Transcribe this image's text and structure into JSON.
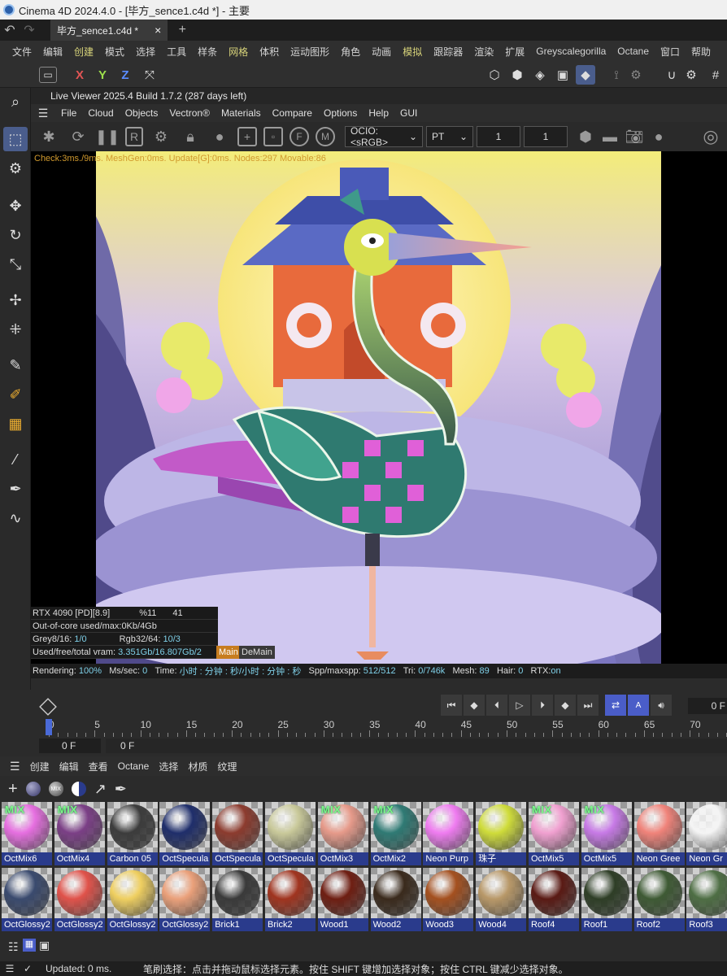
{
  "window": {
    "title": "Cinema 4D 2024.4.0 - [毕方_sence1.c4d *] - 主要"
  },
  "tabbar": {
    "doc_tab": "毕方_sence1.c4d *",
    "close": "×",
    "add": "+"
  },
  "menubar": {
    "items": [
      "文件",
      "编辑",
      "创建",
      "模式",
      "选择",
      "工具",
      "样条",
      "网格",
      "体积",
      "运动图形",
      "角色",
      "动画",
      "模拟",
      "跟踪器",
      "渲染",
      "扩展",
      "Greyscalegorilla",
      "Octane",
      "窗口",
      "帮助"
    ]
  },
  "toolbar1": {
    "axis_x": "X",
    "axis_y": "Y",
    "axis_z": "Z"
  },
  "liveviewer": {
    "title": "Live Viewer 2025.4 Build 1.7.2 (287 days left)",
    "menu": [
      "File",
      "Cloud",
      "Objects",
      "Vectron®",
      "Materials",
      "Compare",
      "Options",
      "Help",
      "GUI"
    ],
    "ocio": "OCIO:<sRGB>",
    "kernel": "PT",
    "field1": "1",
    "field2": "1",
    "check_line": "Check:3ms./9ms. MeshGen:0ms. Update[G]:0ms. Nodes:297 Movable:86"
  },
  "stats": {
    "gpu": "RTX 4090 [PD][8.9]",
    "gpu_pct": "%11",
    "gpu_temp": "41",
    "ooc_label": "Out-of-core used/max:",
    "ooc_value": "0Kb/4Gb",
    "grey_label": "Grey8/16:",
    "grey_value": "1/0",
    "rgb_label": "Rgb32/64:",
    "rgb_value": "10/3",
    "vram_label": "Used/free/total vram:",
    "vram_value": "3.351Gb/16.807Gb/2",
    "main_tab": "Main",
    "demain_tab": "DeMain"
  },
  "render_status": {
    "rendering_label": "Rendering:",
    "rendering_value": "100%",
    "ms_label": "Ms/sec:",
    "ms_value": "0",
    "time_label": "Time:",
    "time_value": "小时 : 分钟 : 秒/小时 : 分钟 : 秒",
    "spp_label": "Spp/maxspp:",
    "spp_value": "512/512",
    "tri_label": "Tri:",
    "tri_value": "0/746k",
    "mesh_label": "Mesh:",
    "mesh_value": "89",
    "hair_label": "Hair:",
    "hair_value": "0",
    "rtx_label": "RTX:",
    "rtx_value": "on"
  },
  "timeline": {
    "frame_right": "0 F",
    "ticks": [
      "0",
      "5",
      "10",
      "15",
      "20",
      "25",
      "30",
      "35",
      "40",
      "45",
      "50",
      "55",
      "60",
      "65",
      "70"
    ],
    "start_frame": "0 F",
    "current_frame": "0 F"
  },
  "material_menu": {
    "items": [
      "创建",
      "编辑",
      "查看",
      "Octane",
      "选择",
      "材质",
      "纹理"
    ]
  },
  "materials": {
    "row1": [
      {
        "name": "OctMix6",
        "mix": "MIX",
        "color": "#e66fe0"
      },
      {
        "name": "OctMix4",
        "mix": "MIX",
        "color": "#7b3f86"
      },
      {
        "name": "Carbon 05",
        "mix": "",
        "color": "#3c3c3c"
      },
      {
        "name": "OctSpecula",
        "mix": "",
        "color": "#1f2e6b"
      },
      {
        "name": "OctSpecula",
        "mix": "",
        "color": "#8c3b2e"
      },
      {
        "name": "OctSpecula",
        "mix": "",
        "color": "#c9c99a"
      },
      {
        "name": "OctMix3",
        "mix": "MIX",
        "color": "#e69a8a"
      },
      {
        "name": "OctMix2",
        "mix": "MIX",
        "color": "#2f7a74"
      },
      {
        "name": "Neon Purp",
        "mix": "",
        "color": "#ef7cf0"
      },
      {
        "name": "珠子",
        "mix": "",
        "color": "#cfdc3a"
      },
      {
        "name": "OctMix5",
        "mix": "MIX",
        "color": "#f0a0d0"
      },
      {
        "name": "OctMix5",
        "mix": "MIX",
        "color": "#c77ae6"
      },
      {
        "name": "Neon Gree",
        "mix": "",
        "color": "#f0837a"
      },
      {
        "name": "Neon Gr",
        "mix": "",
        "color": "#f4f4f4"
      }
    ],
    "row2": [
      {
        "name": "OctGlossy2",
        "color": "#3a4a6e"
      },
      {
        "name": "OctGlossy2",
        "color": "#e0524a"
      },
      {
        "name": "OctGlossy2",
        "color": "#efcf60"
      },
      {
        "name": "OctGlossy2",
        "color": "#eaa07a"
      },
      {
        "name": "Brick1",
        "color": "#3a3a3a"
      },
      {
        "name": "Brick2",
        "color": "#a0341f"
      },
      {
        "name": "Wood1",
        "color": "#6e1e12"
      },
      {
        "name": "Wood2",
        "color": "#3a2a1c"
      },
      {
        "name": "Wood3",
        "color": "#a4501f"
      },
      {
        "name": "Wood4",
        "color": "#b89868"
      },
      {
        "name": "Roof4",
        "color": "#5a1a14"
      },
      {
        "name": "Roof1",
        "color": "#2e3e26"
      },
      {
        "name": "Roof2",
        "color": "#3e5a34"
      },
      {
        "name": "Roof3",
        "color": "#4e6e44"
      }
    ]
  },
  "statusbar": {
    "updated": "Updated: 0 ms.",
    "hint": "笔刷选择：点击并拖动鼠标选择元素。按住 SHIFT 键增加选择对象；按住 CTRL 键减少选择对象。"
  }
}
